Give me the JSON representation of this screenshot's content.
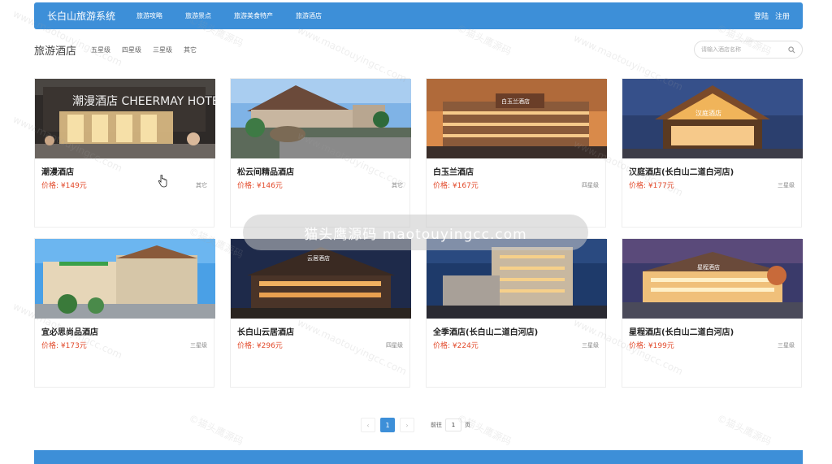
{
  "nav": {
    "brand": "长白山旅游系统",
    "links": [
      "旅游攻略",
      "旅游景点",
      "旅游美食特产",
      "旅游酒店"
    ],
    "login": "登陆",
    "register": "注册"
  },
  "filter": {
    "title": "旅游酒店",
    "levels": [
      "五星级",
      "四星级",
      "三星级",
      "其它"
    ],
    "search_placeholder": "请输入酒店名称"
  },
  "hotels": [
    {
      "name": "潮漫酒店",
      "price": "价格: ¥149元",
      "level": "其它",
      "image_text": "潮漫酒店 CHEERMAY HOTEL"
    },
    {
      "name": "松云间精品酒店",
      "price": "价格: ¥146元",
      "level": "其它"
    },
    {
      "name": "白玉兰酒店",
      "price": "价格: ¥167元",
      "level": "四星级",
      "image_text": "白玉兰酒店"
    },
    {
      "name": "汉庭酒店(长白山二道白河店)",
      "price": "价格: ¥177元",
      "level": "三星级",
      "image_text": "汉庭酒店"
    },
    {
      "name": "宜必思尚品酒店",
      "price": "价格: ¥173元",
      "level": "三星级"
    },
    {
      "name": "长白山云居酒店",
      "price": "价格: ¥296元",
      "level": "四星级",
      "image_text": "云居酒店"
    },
    {
      "name": "全季酒店(长白山二道白河店)",
      "price": "价格: ¥224元",
      "level": "三星级"
    },
    {
      "name": "星程酒店(长白山二道白河店)",
      "price": "价格: ¥199元",
      "level": "三星级",
      "image_text": "星程酒店"
    }
  ],
  "pagination": {
    "prev": "‹",
    "current": "1",
    "next": "›",
    "goto_label": "前往",
    "goto_value": "1",
    "page_suffix": "页"
  },
  "watermark": {
    "center_text": "猫头鹰源码 maotouyingcc.com",
    "repeat_text_1": "www.maotouyingcc.com",
    "repeat_text_2": "©猫头鹰源码"
  },
  "colors": {
    "primary": "#3d8fd8",
    "price": "#e24a2b"
  },
  "icons": {
    "search": "search-icon",
    "cursor": "hand-cursor-icon"
  }
}
